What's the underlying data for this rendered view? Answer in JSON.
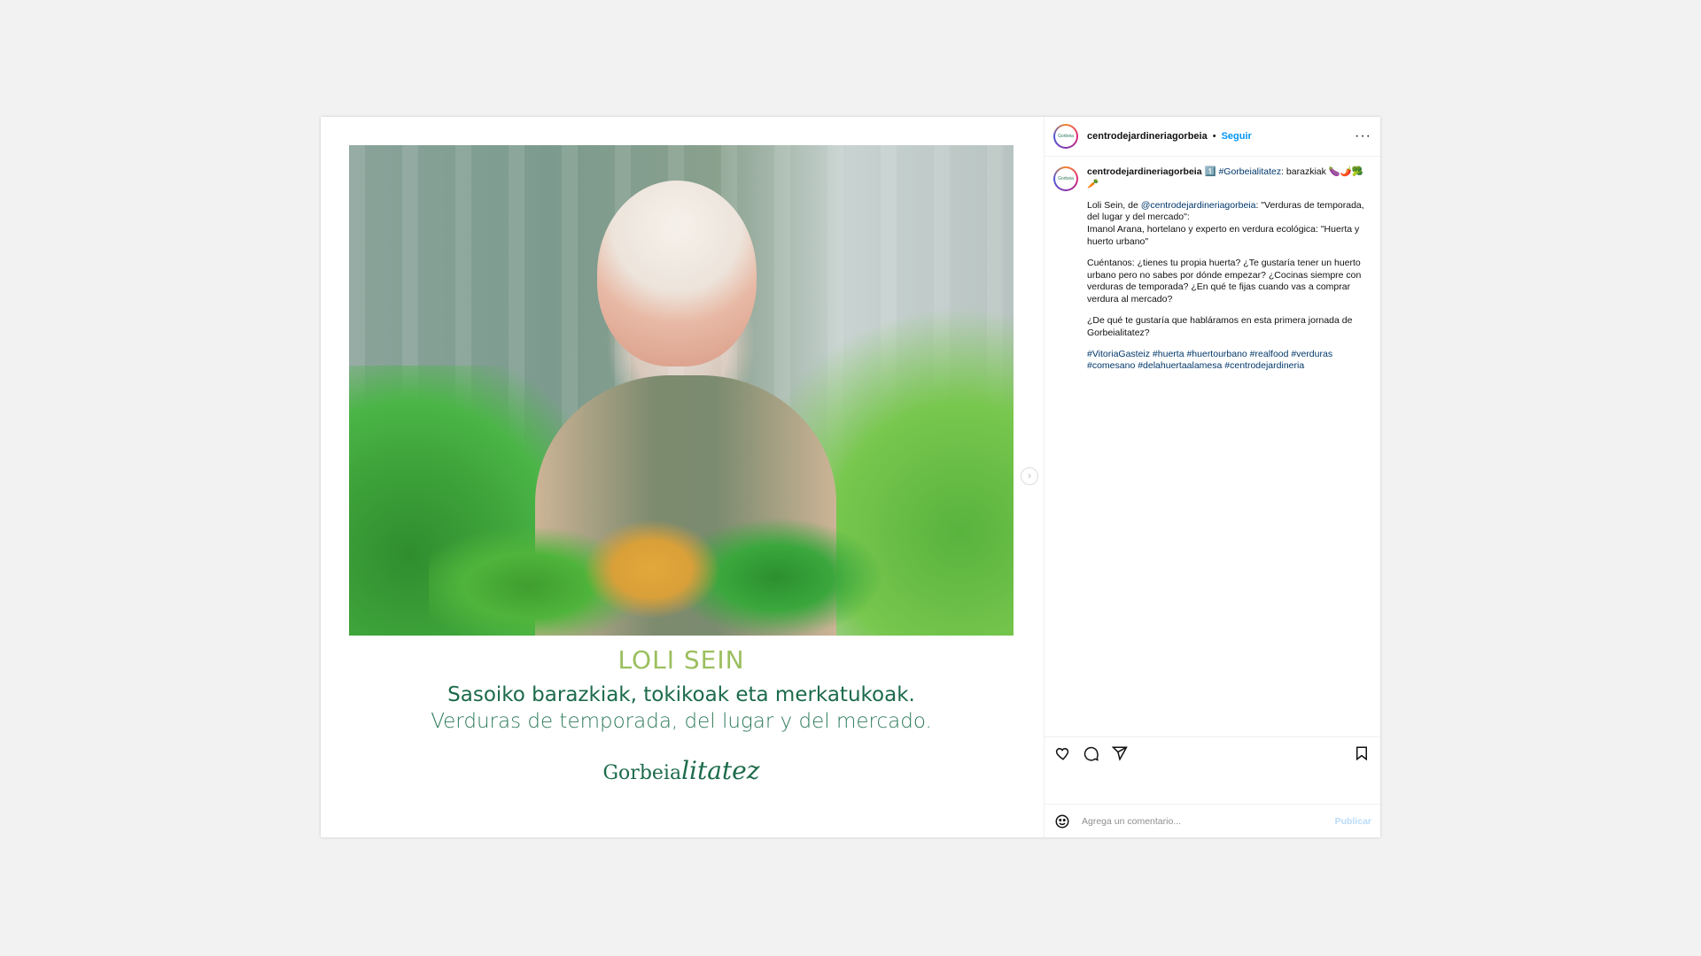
{
  "header": {
    "username": "centrodejardineriagorbeia",
    "separator": "•",
    "follow_label": "Seguir",
    "more_icon": "more-horizontal-icon",
    "more_glyph": "···"
  },
  "avatar": {
    "text": "Gorbeia"
  },
  "post": {
    "image_text": {
      "name": "LOLI SEIN",
      "line1": "Sasoiko barazkiak, tokikoak eta merkatukoak.",
      "line2": "Verduras de temporada, del lugar y del mercado.",
      "brand": "Gorbeia",
      "brand_script": "litatez"
    },
    "next_glyph": "›"
  },
  "caption": {
    "username": "centrodejardineriagorbeia",
    "intro": "1️⃣",
    "hashtag_head": "#Gorbeialitatez",
    "intro_tail": ": barazkiak 🍆🌶️🥦🥕",
    "p1_a": "Loli Sein, de ",
    "p1_mention": "@centrodejardineriagorbeia",
    "p1_b": ": \"Verduras de temporada, del lugar y del mercado\":",
    "p1_c": "Imanol Arana, hortelano y experto en verdura ecológica: \"Huerta y huerto urbano\"",
    "p2": "Cuéntanos: ¿tienes tu propia huerta? ¿Te gustaría tener un huerto urbano pero no sabes por dónde empezar? ¿Cocinas siempre con verduras de temporada? ¿En qué te fijas cuando vas a comprar verdura al mercado?",
    "p3": "¿De qué te gustaría que habláramos en esta primera jornada de Gorbeialitatez?",
    "hashtags": "#VitoriaGasteiz #huerta #huertourbano #realfood #verduras #comesano #delahuertaalamesa #centrodejardineria"
  },
  "actions": {
    "like_icon": "heart-icon",
    "comment_icon": "comment-icon",
    "share_icon": "share-icon",
    "save_icon": "bookmark-icon"
  },
  "comment_box": {
    "placeholder": "Agrega un comentario...",
    "publish_label": "Publicar",
    "emoji_icon": "emoji-icon"
  },
  "colors": {
    "link": "#00376b",
    "follow": "#0095f6",
    "publish_disabled": "#b9dcf8",
    "brand_green": "#1c6b4b",
    "name_green": "#9bbf5e"
  }
}
